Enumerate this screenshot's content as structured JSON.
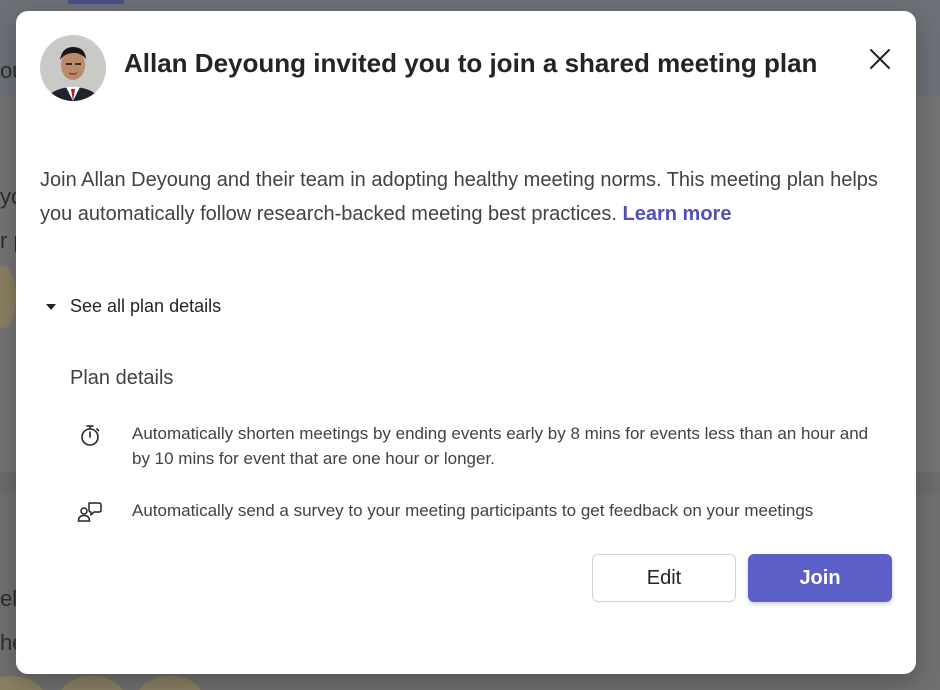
{
  "dialog": {
    "title": "Allan Deyoung invited you to join a shared meeting plan",
    "description": "Join Allan Deyoung and their team in adopting healthy meeting norms. This meeting plan helps you automatically follow research-backed meeting best practices.",
    "learn_more": "Learn more",
    "disclosure_label": "See all plan details",
    "plan_heading": "Plan details",
    "plan_items": [
      {
        "icon": "stopwatch-icon",
        "text": "Automatically shorten meetings by ending events early by 8 mins for events less than an hour and by 10 mins for event that are one hour or longer."
      },
      {
        "icon": "feedback-survey-icon",
        "text": "Automatically send a survey to your meeting participants to get feedback on your meetings"
      }
    ],
    "edit_label": "Edit",
    "join_label": "Join"
  },
  "background": {
    "fragments": [
      "ou",
      "yo",
      "r p",
      "el",
      "he"
    ]
  },
  "colors": {
    "accent": "#5b5fc7",
    "link": "#4f52b2",
    "text": "#242424"
  }
}
